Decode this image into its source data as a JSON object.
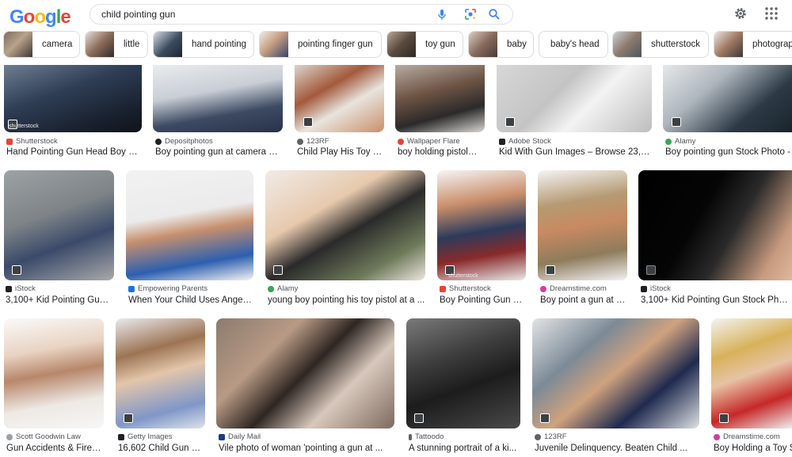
{
  "logo": {
    "text": "Google"
  },
  "search": {
    "query": "child pointing gun"
  },
  "icons": {
    "mic": "mic-icon",
    "lens": "lens-icon",
    "search": "search-icon",
    "settings": "gear-icon",
    "apps": "apps-grid-icon"
  },
  "chips": [
    {
      "label": "camera"
    },
    {
      "label": "little"
    },
    {
      "label": "hand pointing"
    },
    {
      "label": "pointing finger gun"
    },
    {
      "label": "toy gun"
    },
    {
      "label": "baby"
    },
    {
      "label": "baby's head"
    },
    {
      "label": "shutterstock"
    },
    {
      "label": "photograp"
    }
  ],
  "results": {
    "row1": [
      {
        "source": "Shutterstock",
        "title": "Hand Pointing Gun Head Boy St..."
      },
      {
        "source": "Depositphotos",
        "title": "Boy pointing gun at camera St..."
      },
      {
        "source": "123RF",
        "title": "Child Play His Toy G..."
      },
      {
        "source": "Wallpaper Flare",
        "title": "boy holding pistol t..."
      },
      {
        "source": "Adobe Stock",
        "title": "Kid With Gun Images – Browse 23,0..."
      },
      {
        "source": "Alamy",
        "title": "Boy pointing gun Stock Photo - A"
      }
    ],
    "row2": [
      {
        "source": "iStock",
        "title": "3,100+ Kid Pointing Gun ..."
      },
      {
        "source": "Empowering Parents",
        "title": "When Your Child Uses Anger ..."
      },
      {
        "source": "Alamy",
        "title": "young boy pointing his toy pistol at a ..."
      },
      {
        "source": "Shutterstock",
        "title": "Boy Pointing Gun C..."
      },
      {
        "source": "Dreamstime.com",
        "title": "Boy point a gun at y..."
      },
      {
        "source": "iStock",
        "title": "3,100+ Kid Pointing Gun Stock Photos"
      }
    ],
    "row3": [
      {
        "source": "Scott Goodwin Law",
        "title": "Gun Accidents & Firear..."
      },
      {
        "source": "Getty Images",
        "title": "16,602 Child Gun P..."
      },
      {
        "source": "Daily Mail",
        "title": "Vile photo of woman 'pointing a gun at ..."
      },
      {
        "source": "Tattoodo",
        "title": "A stunning portrait of a ki..."
      },
      {
        "source": "123RF",
        "title": "Juvenile Delinquency. Beaten Child ..."
      },
      {
        "source": "Dreamstime.com",
        "title": "Boy Holding a Toy S"
      }
    ]
  },
  "watermarks": {
    "shutterstock": "shutterstock"
  },
  "colors": {
    "accent_blue": "#4285f4",
    "red": "#ea4335",
    "yellow": "#fbbc05",
    "green": "#34a853"
  }
}
